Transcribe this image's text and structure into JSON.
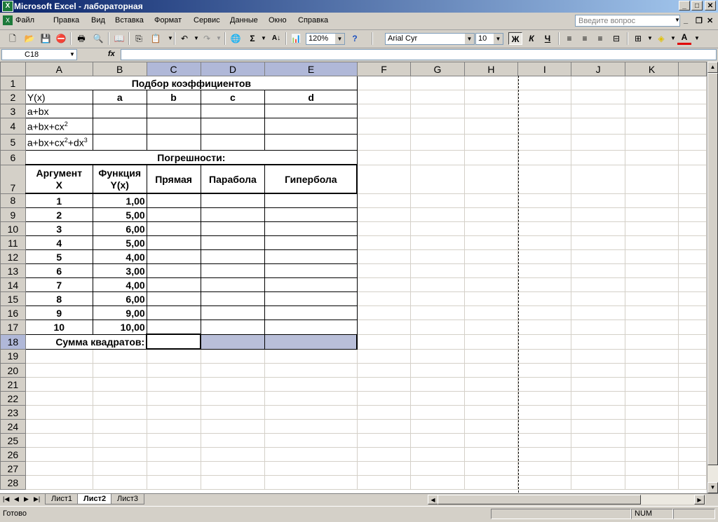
{
  "window": {
    "title": "Microsoft Excel - лабораторная",
    "app_icon": "excel-icon"
  },
  "menu": {
    "items": [
      "Файл",
      "Правка",
      "Вид",
      "Вставка",
      "Формат",
      "Сервис",
      "Данные",
      "Окно",
      "Справка"
    ],
    "help_placeholder": "Введите вопрос"
  },
  "toolbar": {
    "zoom": "120%",
    "font_name": "Arial Cyr",
    "font_size": "10",
    "bold": "Ж",
    "italic": "К",
    "underline": "Ч",
    "sigma": "Σ",
    "font_color_letter": "A"
  },
  "formula_bar": {
    "name_box": "C18",
    "fx": "fx",
    "content": ""
  },
  "grid": {
    "columns": [
      "A",
      "B",
      "C",
      "D",
      "E",
      "F",
      "G",
      "H",
      "I",
      "J",
      "K"
    ],
    "rows": [
      "1",
      "2",
      "3",
      "4",
      "5",
      "6",
      "7",
      "8",
      "9",
      "10",
      "11",
      "12",
      "13",
      "14",
      "15",
      "16",
      "17",
      "18",
      "19",
      "20",
      "21",
      "22",
      "23",
      "24",
      "25",
      "26",
      "27",
      "28"
    ]
  },
  "sheet": {
    "title": "Подбор коэффициентов",
    "header_row": [
      "Y(x)",
      "a",
      "b",
      "c",
      "d"
    ],
    "models": [
      {
        "base": "a+bx",
        "sup1": "",
        "mid": "",
        "sup2": ""
      },
      {
        "base": "a+bx+cx",
        "sup1": "2",
        "mid": "",
        "sup2": ""
      },
      {
        "base": "a+bx+cx",
        "sup1": "2",
        "mid": "+dx",
        "sup2": "3"
      }
    ],
    "errors_title": "Погрешности:",
    "table_header": {
      "arg_line1": "Аргумент",
      "arg_line2": "X",
      "func_line1": "Функция",
      "func_line2": "Y(x)",
      "col_c": "Прямая",
      "col_d": "Парабола",
      "col_e": "Гипербола"
    },
    "data": [
      {
        "x": "1",
        "y": "1,00"
      },
      {
        "x": "2",
        "y": "5,00"
      },
      {
        "x": "3",
        "y": "6,00"
      },
      {
        "x": "4",
        "y": "5,00"
      },
      {
        "x": "5",
        "y": "4,00"
      },
      {
        "x": "6",
        "y": "3,00"
      },
      {
        "x": "7",
        "y": "4,00"
      },
      {
        "x": "8",
        "y": "6,00"
      },
      {
        "x": "9",
        "y": "9,00"
      },
      {
        "x": "10",
        "y": "10,00"
      }
    ],
    "sum_label": "Сумма квадратов:"
  },
  "tabs": {
    "items": [
      "Лист1",
      "Лист2",
      "Лист3"
    ],
    "active": "Лист2"
  },
  "status": {
    "text": "Готово",
    "num": "NUM"
  },
  "colors": {
    "title_bar": "#0a246a",
    "selection": "#b9bfd9",
    "chrome": "#d4d0c8"
  }
}
